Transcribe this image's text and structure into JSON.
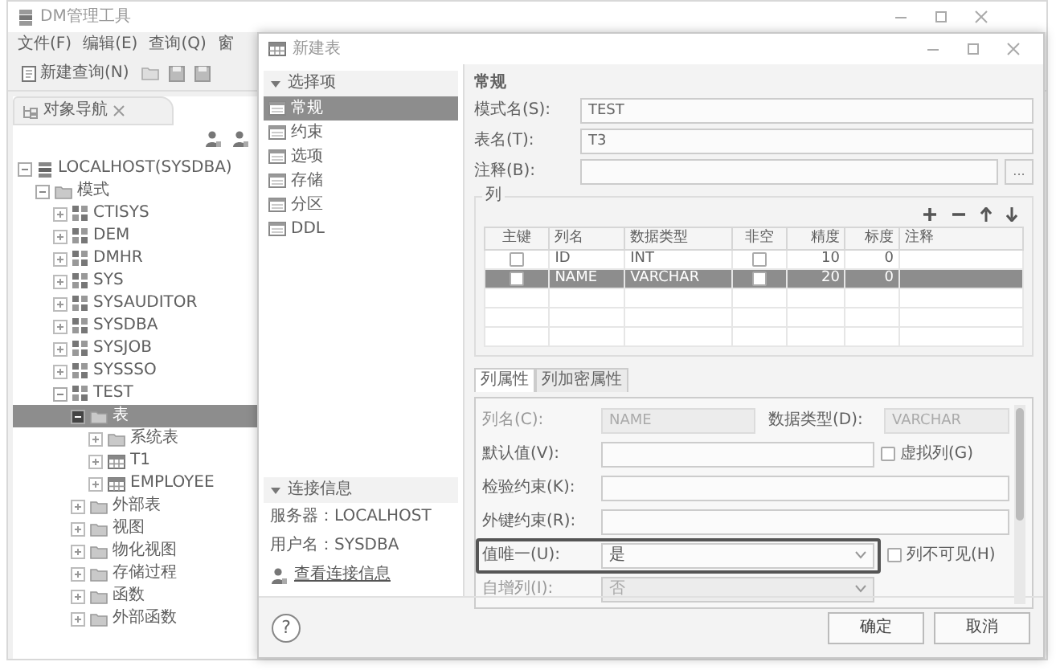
{
  "main_window": {
    "title": "DM管理工具",
    "menu": [
      "文件(F)",
      "编辑(E)",
      "查询(Q)",
      "窗"
    ],
    "toolbar": {
      "new_query": "新建查询(N)"
    },
    "panel_tab": "对象导航",
    "tree": [
      {
        "label": "LOCALHOST(SYSDBA)",
        "kind": "server",
        "expanded": true,
        "selected": false,
        "children": [
          {
            "label": "模式",
            "kind": "folder",
            "expanded": true,
            "selected": false,
            "children": [
              {
                "label": "CTISYS",
                "kind": "schema",
                "expanded": false,
                "selected": false
              },
              {
                "label": "DEM",
                "kind": "schema",
                "expanded": false,
                "selected": false
              },
              {
                "label": "DMHR",
                "kind": "schema",
                "expanded": false,
                "selected": false
              },
              {
                "label": "SYS",
                "kind": "schema",
                "expanded": false,
                "selected": false
              },
              {
                "label": "SYSAUDITOR",
                "kind": "schema",
                "expanded": false,
                "selected": false
              },
              {
                "label": "SYSDBA",
                "kind": "schema",
                "expanded": false,
                "selected": false
              },
              {
                "label": "SYSJOB",
                "kind": "schema",
                "expanded": false,
                "selected": false
              },
              {
                "label": "SYSSSO",
                "kind": "schema",
                "expanded": false,
                "selected": false
              },
              {
                "label": "TEST",
                "kind": "schema",
                "expanded": true,
                "selected": false,
                "children": [
                  {
                    "label": "表",
                    "kind": "folder",
                    "expanded": true,
                    "selected": true,
                    "children": [
                      {
                        "label": "系统表",
                        "kind": "folder",
                        "expanded": false,
                        "selected": false
                      },
                      {
                        "label": "T1",
                        "kind": "table",
                        "expanded": false,
                        "selected": false
                      },
                      {
                        "label": "EMPLOYEE",
                        "kind": "table",
                        "expanded": false,
                        "selected": false
                      }
                    ]
                  },
                  {
                    "label": "外部表",
                    "kind": "folder",
                    "expanded": false,
                    "selected": false
                  },
                  {
                    "label": "视图",
                    "kind": "folder",
                    "expanded": false,
                    "selected": false
                  },
                  {
                    "label": "物化视图",
                    "kind": "folder",
                    "expanded": false,
                    "selected": false
                  },
                  {
                    "label": "存储过程",
                    "kind": "folder",
                    "expanded": false,
                    "selected": false
                  },
                  {
                    "label": "函数",
                    "kind": "folder",
                    "expanded": false,
                    "selected": false
                  },
                  {
                    "label": "外部函数",
                    "kind": "folder",
                    "expanded": false,
                    "selected": false
                  }
                ]
              }
            ]
          }
        ]
      }
    ]
  },
  "dialog": {
    "title": "新建表",
    "options_header": "选择项",
    "options": [
      {
        "label": "常规",
        "selected": true
      },
      {
        "label": "约束",
        "selected": false
      },
      {
        "label": "选项",
        "selected": false
      },
      {
        "label": "存储",
        "selected": false
      },
      {
        "label": "分区",
        "selected": false
      },
      {
        "label": "DDL",
        "selected": false
      }
    ],
    "connection_header": "连接信息",
    "connection_info": [
      "服务器：LOCALHOST",
      "用户名：SYSDBA"
    ],
    "connection_link": "查看连接信息",
    "section_title": "常规",
    "fields": [
      {
        "label": "模式名(S):",
        "value": "TEST"
      },
      {
        "label": "表名(T):",
        "value": "T3"
      },
      {
        "label": "注释(B):",
        "button": "..."
      }
    ],
    "columns_group": {
      "title": "列",
      "columns": [
        "主键",
        "列名",
        "数据类型",
        "非空",
        "精度",
        "标度",
        "注释"
      ],
      "rows": [
        {
          "primary_key": false,
          "name": "ID",
          "type": "INT",
          "not_null": false,
          "precision": "10",
          "scale": "0",
          "selected": false
        },
        {
          "primary_key": false,
          "name": "NAME",
          "type": "VARCHAR",
          "not_null": false,
          "precision": "20",
          "scale": "0",
          "selected": true
        }
      ]
    },
    "property_tabs": [
      {
        "label": "列属性",
        "selected": true
      },
      {
        "label": "列加密属性",
        "selected": false
      }
    ],
    "properties": [
      {
        "kind": "text",
        "label": "列名(C):",
        "value": "NAME",
        "disabled": true,
        "highlighted": false,
        "extra": {
          "kind": "text",
          "label": "数据类型(D):",
          "value": "VARCHAR",
          "disabled": true
        }
      },
      {
        "kind": "text",
        "label": "默认值(V):",
        "disabled": false,
        "highlighted": false,
        "extra": {
          "kind": "checkbox",
          "label": "虚拟列(G)",
          "checked": false
        }
      },
      {
        "kind": "text",
        "label": "检验约束(K):",
        "disabled": false,
        "highlighted": false
      },
      {
        "kind": "text",
        "label": "外键约束(R):",
        "disabled": false,
        "highlighted": false
      },
      {
        "kind": "select",
        "label": "值唯一(U):",
        "value": "是",
        "disabled": false,
        "highlighted": true,
        "extra": {
          "kind": "checkbox",
          "label": "列不可见(H)",
          "checked": false
        }
      },
      {
        "kind": "select",
        "label": "自增列(I):",
        "value": "否",
        "disabled": true,
        "highlighted": false
      }
    ],
    "help_button": "?",
    "buttons": [
      "确定",
      "取消"
    ]
  }
}
